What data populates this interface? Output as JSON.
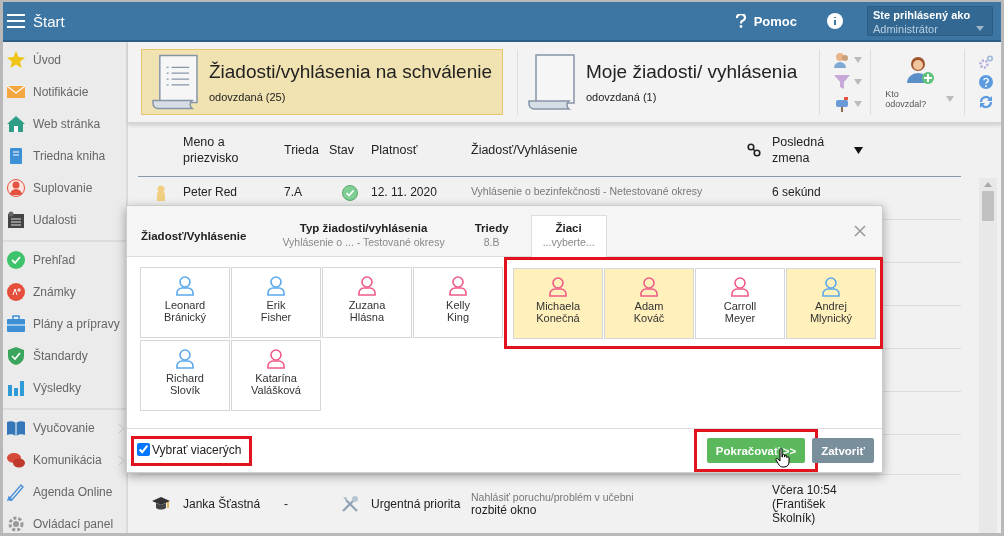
{
  "topbar": {
    "title": "Štart",
    "help": "Pomoc",
    "user_caption": "Ste prihlásený ako",
    "user_role": "Administrátor"
  },
  "sidebar": {
    "groups": [
      {
        "items": [
          {
            "label": "Úvod",
            "submenu": false
          },
          {
            "label": "Notifikácie",
            "submenu": false
          },
          {
            "label": "Web stránka",
            "submenu": false
          },
          {
            "label": "Triedna kniha",
            "submenu": false
          },
          {
            "label": "Suplovanie",
            "submenu": false
          },
          {
            "label": "Udalosti",
            "submenu": false
          }
        ]
      },
      {
        "items": [
          {
            "label": "Prehľad",
            "submenu": false
          },
          {
            "label": "Známky",
            "submenu": false
          },
          {
            "label": "Plány a prípravy",
            "submenu": false
          },
          {
            "label": "Štandardy",
            "submenu": false
          },
          {
            "label": "Výsledky",
            "submenu": false
          }
        ]
      },
      {
        "items": [
          {
            "label": "Vyučovanie",
            "submenu": true
          },
          {
            "label": "Komunikácia",
            "submenu": true
          },
          {
            "label": "Agenda Online",
            "submenu": false
          },
          {
            "label": "Ovládací panel",
            "submenu": false
          }
        ]
      }
    ]
  },
  "cards": [
    {
      "title": "Žiadosti/vyhlásenia na schválenie",
      "subtitle": "odovzdaná (25)",
      "selected": true
    },
    {
      "title": "Moje žiadosti/ vyhlásenia",
      "subtitle": "odovzdaná (1)",
      "selected": false
    }
  ],
  "toolbar": {
    "who_label": "Kto odovzdal?"
  },
  "table": {
    "columns": [
      "Meno a priezvisko",
      "Trieda",
      "Stav",
      "Platnosť",
      "Žiadosť/Vyhlásenie",
      "Posledná zmena"
    ],
    "rows": [
      {
        "kind": "student",
        "name": "Peter Red",
        "class": "7.A",
        "approved": true,
        "validity": "12. 11. 2020",
        "request_type": "Vyhlásenie o bezinfekčnosti - Netestované okresy",
        "changed": "6 sekúnd"
      },
      {
        "kind": "staff",
        "name": "Janka Šťastná",
        "class": "-",
        "approved": false,
        "validity": "Urgentná priorita",
        "request_type": "Nahlásiť poruchu/problém v učebni",
        "request": "rozbité okno",
        "changed": "Včera 10:54 (František Školník)"
      }
    ]
  },
  "dialog": {
    "tabs": [
      {
        "label": "Žiadosť/Vyhlásenie",
        "selected": false
      },
      {
        "label": "Typ žiadosti/vyhlásenia",
        "sub": "Vyhlásenie o ... - Testované okresy",
        "selected": false
      },
      {
        "label": "Triedy",
        "sub": "8.B",
        "selected": false
      },
      {
        "label": "Žiaci",
        "sub": "...vyberte...",
        "selected": true
      }
    ],
    "student_rows": [
      [
        {
          "first": "Leonard",
          "last": "Bránický",
          "color": "#5aa9ec",
          "selected": false,
          "framed": false
        },
        {
          "first": "Erik",
          "last": "Fisher",
          "color": "#5aa9ec",
          "selected": false,
          "framed": false
        },
        {
          "first": "Zuzana",
          "last": "Hlásna",
          "color": "#ee5b86",
          "selected": false,
          "framed": false
        },
        {
          "first": "Kelly",
          "last": "King",
          "color": "#ee5b86",
          "selected": false,
          "framed": false
        },
        {
          "first": "Michaela",
          "last": "Konečná",
          "color": "#ee5b86",
          "selected": true,
          "framed": true
        },
        {
          "first": "Adam",
          "last": "Kováč",
          "color": "#ee5b86",
          "selected": true,
          "framed": true
        },
        {
          "first": "Carroll",
          "last": "Meyer",
          "color": "#ee5b86",
          "selected": false,
          "framed": true
        },
        {
          "first": "Andrej",
          "last": "Mlynický",
          "color": "#5aa9ec",
          "selected": true,
          "framed": true
        }
      ],
      [
        {
          "first": "Richard",
          "last": "Slovík",
          "color": "#5aa9ec",
          "selected": false,
          "framed": false
        },
        {
          "first": "Katarína",
          "last": "Valášková",
          "color": "#ee5b86",
          "selected": false,
          "framed": false
        }
      ]
    ],
    "multi_select": {
      "label": "Vybrať viacerých",
      "checked": true
    },
    "buttons": [
      {
        "kind": "primary",
        "label": "Pokračovať >>"
      },
      {
        "kind": "secondary",
        "label": "Zatvoriť"
      }
    ]
  }
}
